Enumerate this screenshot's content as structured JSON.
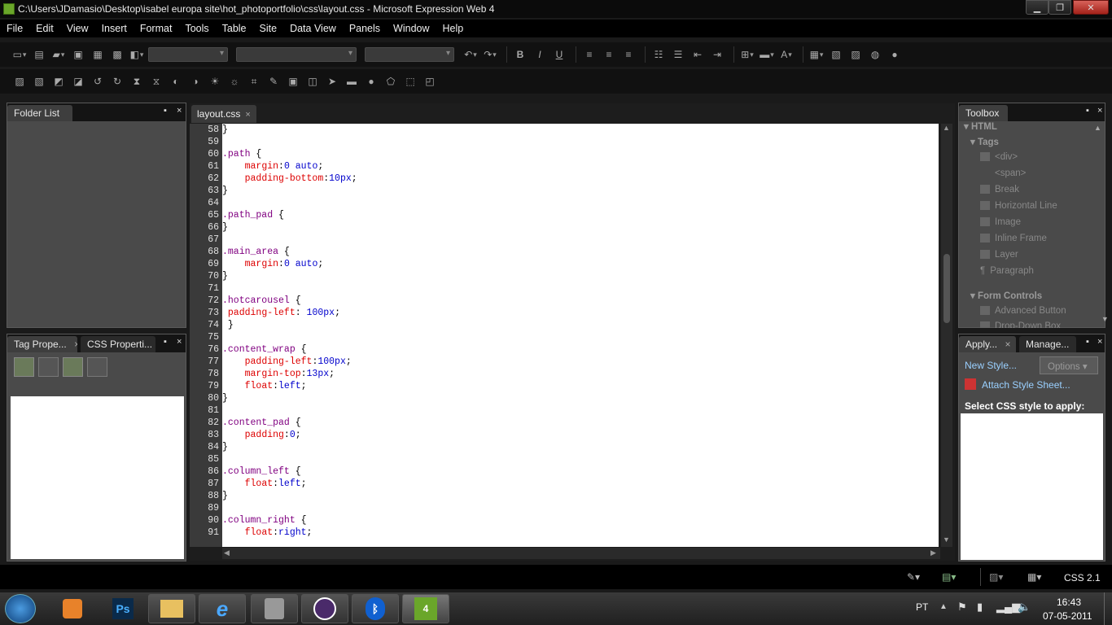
{
  "window": {
    "title": "C:\\Users\\JDamasio\\Desktop\\isabel europa site\\hot_photoportfolio\\css\\layout.css - Microsoft Expression Web 4"
  },
  "menu": [
    "File",
    "Edit",
    "View",
    "Insert",
    "Format",
    "Tools",
    "Table",
    "Site",
    "Data View",
    "Panels",
    "Window",
    "Help"
  ],
  "panels": {
    "folder_list": "Folder List",
    "tag_properties": "Tag Prope...",
    "css_properties": "CSS Properti...",
    "toolbox": "Toolbox",
    "apply_styles": "Apply...",
    "manage_styles": "Manage...",
    "pin": "📌",
    "close": "×"
  },
  "editor": {
    "tab": "layout.css",
    "tab_close": "×"
  },
  "code": [
    {
      "n": "58",
      "parts": [
        [
          "plain",
          "}"
        ]
      ]
    },
    {
      "n": "59",
      "parts": []
    },
    {
      "n": "60",
      "parts": [
        [
          "sel",
          ".path "
        ],
        [
          "plain",
          "{"
        ]
      ]
    },
    {
      "n": "61",
      "parts": [
        [
          "plain",
          "    "
        ],
        [
          "prop",
          "margin"
        ],
        [
          "plain",
          ":"
        ],
        [
          "val",
          "0 auto"
        ],
        [
          "plain",
          ";"
        ]
      ]
    },
    {
      "n": "62",
      "parts": [
        [
          "plain",
          "    "
        ],
        [
          "prop",
          "padding-bottom"
        ],
        [
          "plain",
          ":"
        ],
        [
          "val",
          "10px"
        ],
        [
          "plain",
          ";"
        ]
      ]
    },
    {
      "n": "63",
      "parts": [
        [
          "plain",
          "}"
        ]
      ]
    },
    {
      "n": "64",
      "parts": []
    },
    {
      "n": "65",
      "parts": [
        [
          "sel",
          ".path_pad "
        ],
        [
          "plain",
          "{"
        ]
      ]
    },
    {
      "n": "66",
      "parts": [
        [
          "plain",
          "}"
        ]
      ]
    },
    {
      "n": "67",
      "parts": []
    },
    {
      "n": "68",
      "parts": [
        [
          "sel",
          ".main_area "
        ],
        [
          "plain",
          "{"
        ]
      ]
    },
    {
      "n": "69",
      "parts": [
        [
          "plain",
          "    "
        ],
        [
          "prop",
          "margin"
        ],
        [
          "plain",
          ":"
        ],
        [
          "val",
          "0 auto"
        ],
        [
          "plain",
          ";"
        ]
      ]
    },
    {
      "n": "70",
      "parts": [
        [
          "plain",
          "}"
        ]
      ]
    },
    {
      "n": "71",
      "parts": []
    },
    {
      "n": "72",
      "parts": [
        [
          "sel",
          ".hotcarousel "
        ],
        [
          "plain",
          "{"
        ]
      ]
    },
    {
      "n": "73",
      "parts": [
        [
          "plain",
          " "
        ],
        [
          "prop",
          "padding-left"
        ],
        [
          "plain",
          ": "
        ],
        [
          "val",
          "100px"
        ],
        [
          "plain",
          ";"
        ]
      ]
    },
    {
      "n": "74",
      "parts": [
        [
          "plain",
          " }"
        ]
      ]
    },
    {
      "n": "75",
      "parts": []
    },
    {
      "n": "76",
      "parts": [
        [
          "sel",
          ".content_wrap "
        ],
        [
          "plain",
          "{"
        ]
      ]
    },
    {
      "n": "77",
      "parts": [
        [
          "plain",
          "    "
        ],
        [
          "prop",
          "padding-left"
        ],
        [
          "plain",
          ":"
        ],
        [
          "val",
          "100px"
        ],
        [
          "plain",
          ";"
        ]
      ]
    },
    {
      "n": "78",
      "parts": [
        [
          "plain",
          "    "
        ],
        [
          "prop",
          "margin-top"
        ],
        [
          "plain",
          ":"
        ],
        [
          "val",
          "13px"
        ],
        [
          "plain",
          ";"
        ]
      ]
    },
    {
      "n": "79",
      "parts": [
        [
          "plain",
          "    "
        ],
        [
          "prop",
          "float"
        ],
        [
          "plain",
          ":"
        ],
        [
          "val",
          "left"
        ],
        [
          "plain",
          ";"
        ]
      ]
    },
    {
      "n": "80",
      "parts": [
        [
          "plain",
          "}"
        ]
      ]
    },
    {
      "n": "81",
      "parts": []
    },
    {
      "n": "82",
      "parts": [
        [
          "sel",
          ".content_pad "
        ],
        [
          "plain",
          "{"
        ]
      ]
    },
    {
      "n": "83",
      "parts": [
        [
          "plain",
          "    "
        ],
        [
          "prop",
          "padding"
        ],
        [
          "plain",
          ":"
        ],
        [
          "val",
          "0"
        ],
        [
          "plain",
          ";"
        ]
      ]
    },
    {
      "n": "84",
      "parts": [
        [
          "plain",
          "}"
        ]
      ]
    },
    {
      "n": "85",
      "parts": []
    },
    {
      "n": "86",
      "parts": [
        [
          "sel",
          ".column_left "
        ],
        [
          "plain",
          "{"
        ]
      ]
    },
    {
      "n": "87",
      "parts": [
        [
          "plain",
          "    "
        ],
        [
          "prop",
          "float"
        ],
        [
          "plain",
          ":"
        ],
        [
          "val",
          "left"
        ],
        [
          "plain",
          ";"
        ]
      ]
    },
    {
      "n": "88",
      "parts": [
        [
          "plain",
          "}"
        ]
      ]
    },
    {
      "n": "89",
      "parts": []
    },
    {
      "n": "90",
      "parts": [
        [
          "sel",
          ".column_right "
        ],
        [
          "plain",
          "{"
        ]
      ]
    },
    {
      "n": "91",
      "parts": [
        [
          "plain",
          "    "
        ],
        [
          "prop",
          "float"
        ],
        [
          "plain",
          ":"
        ],
        [
          "val",
          "right"
        ],
        [
          "plain",
          ";"
        ]
      ]
    }
  ],
  "toolbox": {
    "html": "HTML",
    "tags": "Tags",
    "items": [
      "<div>",
      "<span>",
      "Break",
      "Horizontal Line",
      "Image",
      "Inline Frame",
      "Layer",
      "Paragraph"
    ],
    "form_controls": "Form Controls",
    "advanced_button": "Advanced Button",
    "drop_down_box": "Drop-Down Box"
  },
  "apply_styles": {
    "new_style": "New Style...",
    "options": "Options",
    "attach": "Attach Style Sheet...",
    "select_label": "Select CSS style to apply:"
  },
  "status": {
    "schema": "CSS 2.1"
  },
  "taskbar": {
    "language": "PT",
    "time": "16:43",
    "date": "07-05-2011",
    "ps_label": "Ps",
    "ew_label": "4"
  }
}
